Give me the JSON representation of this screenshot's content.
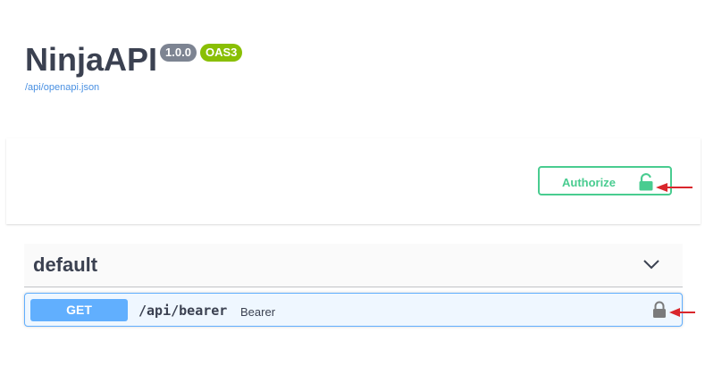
{
  "info": {
    "title": "NinjaAPI",
    "version": "1.0.0",
    "oas_badge": "OAS3",
    "spec_url": "/api/openapi.json"
  },
  "authorize": {
    "label": "Authorize",
    "icon": "lock-open-icon"
  },
  "tag": {
    "name": "default",
    "icon": "chevron-down-icon"
  },
  "operations": [
    {
      "method": "GET",
      "path": "/api/bearer",
      "summary": "Bearer",
      "icon": "lock-icon"
    }
  ],
  "colors": {
    "get": "#61affe",
    "authorize": "#49cc90",
    "oas_badge": "#89bf04",
    "version_badge": "#7d8492",
    "annotation_arrow": "#d9262c"
  }
}
